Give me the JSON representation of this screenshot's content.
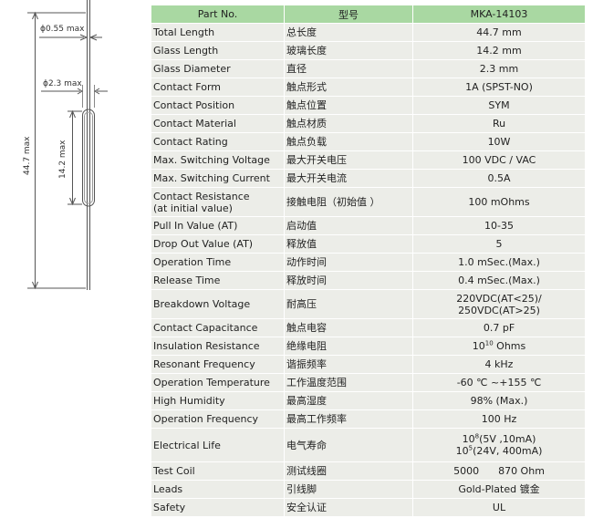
{
  "drawing": {
    "lead_diameter": "0.55 max",
    "glass_diameter": "2.3 max",
    "total_length": "44.7 max",
    "glass_length": "14.2 max",
    "diameter_symbol": "ϕ"
  },
  "table": {
    "headers": [
      "Part No.",
      "型号",
      "MKA-14103"
    ],
    "rows": [
      {
        "en": "Total Length",
        "cn": "总长度",
        "value": "44.7 mm"
      },
      {
        "en": "Glass Length",
        "cn": "玻璃长度",
        "value": "14.2 mm"
      },
      {
        "en": "Glass Diameter",
        "cn": "直径",
        "value": "2.3 mm"
      },
      {
        "en": "Contact Form",
        "cn": "触点形式",
        "value": "1A (SPST-NO)"
      },
      {
        "en": "Contact Position",
        "cn": "触点位置",
        "value": "SYM"
      },
      {
        "en": "Contact Material",
        "cn": "触点材质",
        "value": "Ru"
      },
      {
        "en": "Contact Rating",
        "cn": "触点负载",
        "value": "10W"
      },
      {
        "en": "Max. Switching Voltage",
        "cn": "最大开关电压",
        "value": "100 VDC / VAC"
      },
      {
        "en": "Max. Switching Current",
        "cn": "最大开关电流",
        "value": "0.5A"
      },
      {
        "en": "Contact Resistance",
        "en2": "(at initial value)",
        "cn": "接触电阻（初始值 ）",
        "value": "100 mOhms"
      },
      {
        "en": "Pull In Value (AT)",
        "cn": "启动值",
        "value": "10-35"
      },
      {
        "en": "Drop Out Value (AT)",
        "cn": "释放值",
        "value": "5"
      },
      {
        "en": "Operation Time",
        "cn": "动作时间",
        "value": "1.0 mSec.(Max.)"
      },
      {
        "en": "Release Time",
        "cn": "释放时间",
        "value": "0.4 mSec.(Max.)"
      },
      {
        "en": "Breakdown Voltage",
        "cn": "耐高压",
        "value": "220VDC(AT<25)/",
        "value2": "250VDC(AT>25)"
      },
      {
        "en": "Contact Capacitance",
        "cn": "触点电容",
        "value": "0.7 pF"
      },
      {
        "en": "Insulation Resistance",
        "cn": "绝缘电阻",
        "value_base": "10",
        "value_sup": "10",
        "value_tail": " Ohms"
      },
      {
        "en": "Resonant Frequency",
        "cn": "谐振频率",
        "value": "4 kHz"
      },
      {
        "en": "Operation Temperature",
        "cn": "工作温度范围",
        "value": "-60 ℃ ~+155 ℃"
      },
      {
        "en": "High Humidity",
        "cn": "最高湿度",
        "value": "98% (Max.)"
      },
      {
        "en": "Operation Frequency",
        "cn": "最高工作频率",
        "value": "100 Hz"
      },
      {
        "en": "Electrical Life",
        "cn": "电气寿命",
        "l1_base": "10",
        "l1_sup": "8",
        "l1_tail": "(5V ,10mA)",
        "l2_base": "10",
        "l2_sup": "5",
        "l2_tail": "(24V, 400mA)"
      },
      {
        "en": "Test Coil",
        "cn": "测试线圈",
        "value": "5000      870 Ohm"
      },
      {
        "en": "Leads",
        "cn": "引线脚",
        "value": "Gold-Plated 镀金"
      },
      {
        "en": "Safety",
        "cn": "安全认证",
        "value": "UL"
      }
    ]
  }
}
